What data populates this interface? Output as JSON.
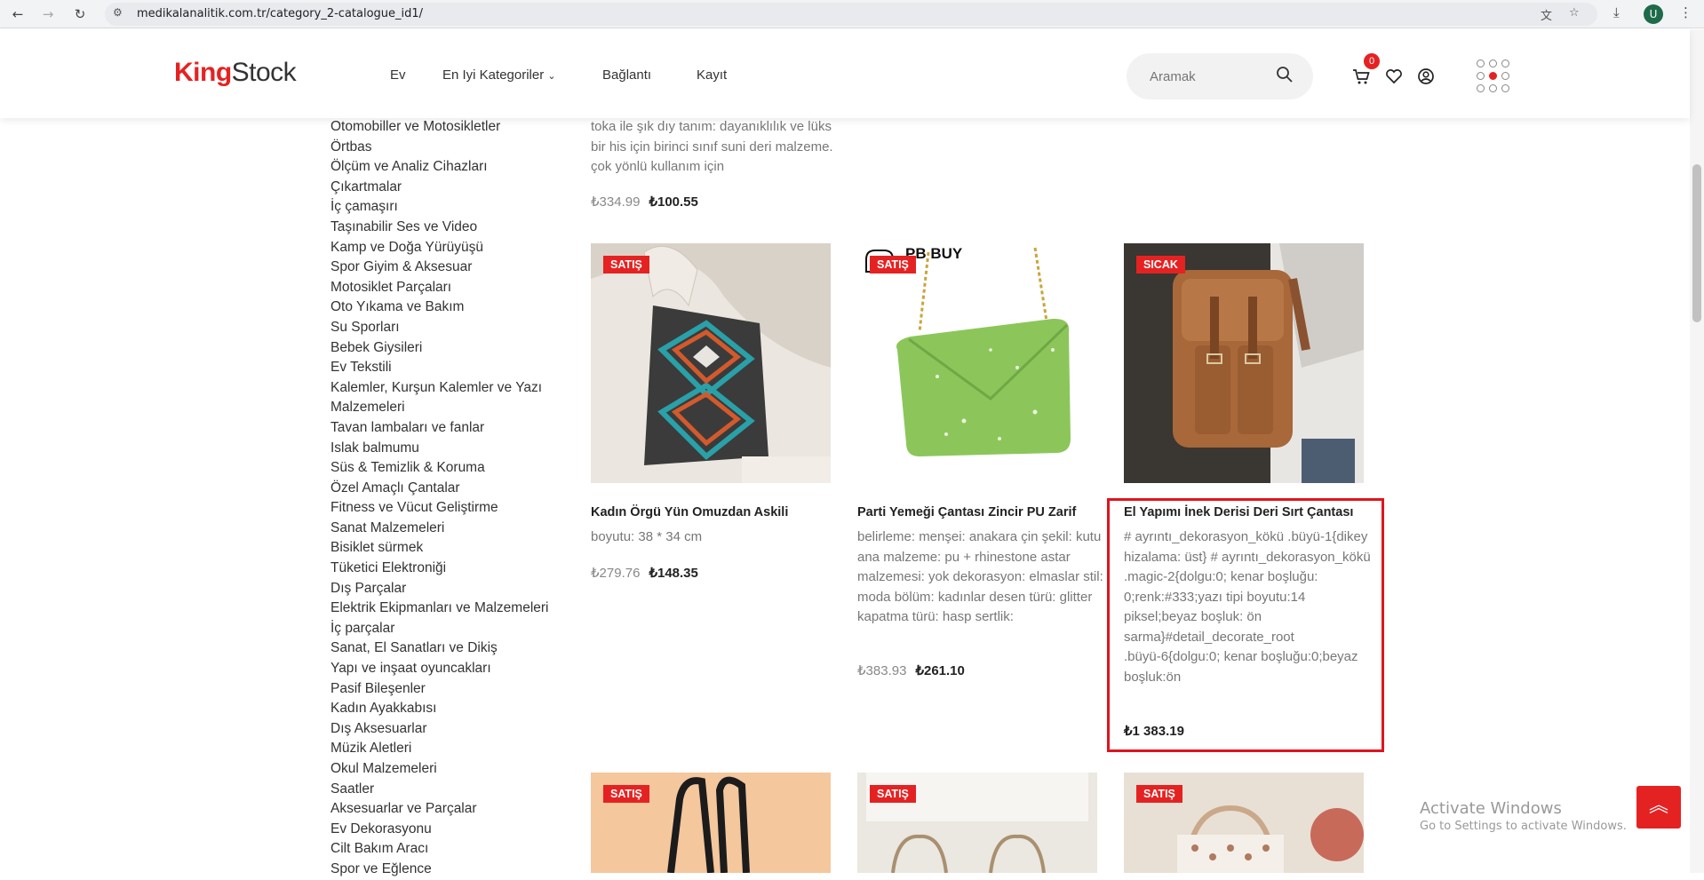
{
  "browser": {
    "url": "medikalanalitik.com.tr/category_2-catalogue_id1/",
    "profile_initial": "U"
  },
  "header": {
    "logo_part1": "King",
    "logo_part2": "Stock",
    "nav": [
      "Ev",
      "En Iyi Kategoriler",
      "Bağlantı",
      "Kayıt"
    ],
    "search_placeholder": "Aramak",
    "cart_count": "0"
  },
  "sidebar": {
    "categories": [
      "Otomobiller ve Motosikletler",
      "Örtbas",
      "Ölçüm ve Analiz Cihazları",
      "Çıkartmalar",
      "İç çamaşırı",
      "Taşınabilir Ses ve Video",
      "Kamp ve Doğa Yürüyüşü",
      "Spor Giyim & Aksesuar",
      "Motosiklet Parçaları",
      "Oto Yıkama ve Bakım",
      "Su Sporları",
      "Bebek Giysileri",
      "Ev Tekstili",
      "Kalemler, Kurşun Kalemler ve Yazı Malzemeleri",
      "Tavan lambaları ve fanlar",
      "Islak balmumu",
      "Süs & Temizlik & Koruma",
      "Özel Amaçlı Çantalar",
      "Fitness ve Vücut Geliştirme",
      "Sanat Malzemeleri",
      "Bisiklet sürmek",
      "Tüketici Elektroniği",
      "Dış Parçalar",
      "Elektrik Ekipmanları ve Malzemeleri",
      "İç parçalar",
      "Sanat, El Sanatları ve Dikiş",
      "Yapı ve inşaat oyuncakları",
      "Pasif Bileşenler",
      "Kadın Ayakkabısı",
      "Dış Aksesuarlar",
      "Müzik Aletleri",
      "Okul Malzemeleri",
      "Saatler",
      "Aksesuarlar ve Parçalar",
      "Ev Dekorasyonu",
      "Cilt Bakım Aracı",
      "Spor ve Eğlence"
    ]
  },
  "top_product": {
    "desc": "toka ile şık dıy tanım: dayanıklılık ve lüks bir his için birinci sınıf suni deri malzeme. çok yönlü kullanım için",
    "old_price": "₺334.99",
    "new_price": "₺100.55"
  },
  "products": [
    {
      "badge": "SATIŞ",
      "title": "Kadın Örgü Yün Omuzdan Askili",
      "desc": "boyutu: 38 * 34 cm",
      "old_price": "₺279.76",
      "new_price": "₺148.35"
    },
    {
      "badge": "SATIŞ",
      "title": "Parti Yemeği Çantası Zincir PU Zarif",
      "desc": "belirleme: menşei: anakara çin şekil: kutu ana malzeme: pu + rhinestone astar malzemesi: yok dekorasyon: elmaslar stil: moda bölüm: kadınlar desen türü: glitter kapatma türü: hasp sertlik:",
      "old_price": "₺383.93",
      "new_price": "₺261.10",
      "img_text": "PB BUY"
    },
    {
      "badge": "SICAK",
      "title": "El Yapımı İnek Derisi Deri Sırt Çantası",
      "desc": "# ayrıntı_dekorasyon_kökü .büyü-1{dikey hizalama: üst} # ayrıntı_dekorasyon_kökü .magic-2{dolgu:0; kenar boşluğu: 0;renk:#333;yazı tipi boyutu:14 piksel;beyaz boşluk: ön sarma}#detail_decorate_root .büyü-6{dolgu:0; kenar boşluğu:0;beyaz boşluk:ön",
      "new_price": "₺1 383.19"
    }
  ],
  "bottom_badges": [
    "SATIŞ",
    "SATIŞ",
    "SATIŞ"
  ],
  "windows_notice": {
    "line1": "Activate Windows",
    "line2": "Go to Settings to activate Windows."
  }
}
